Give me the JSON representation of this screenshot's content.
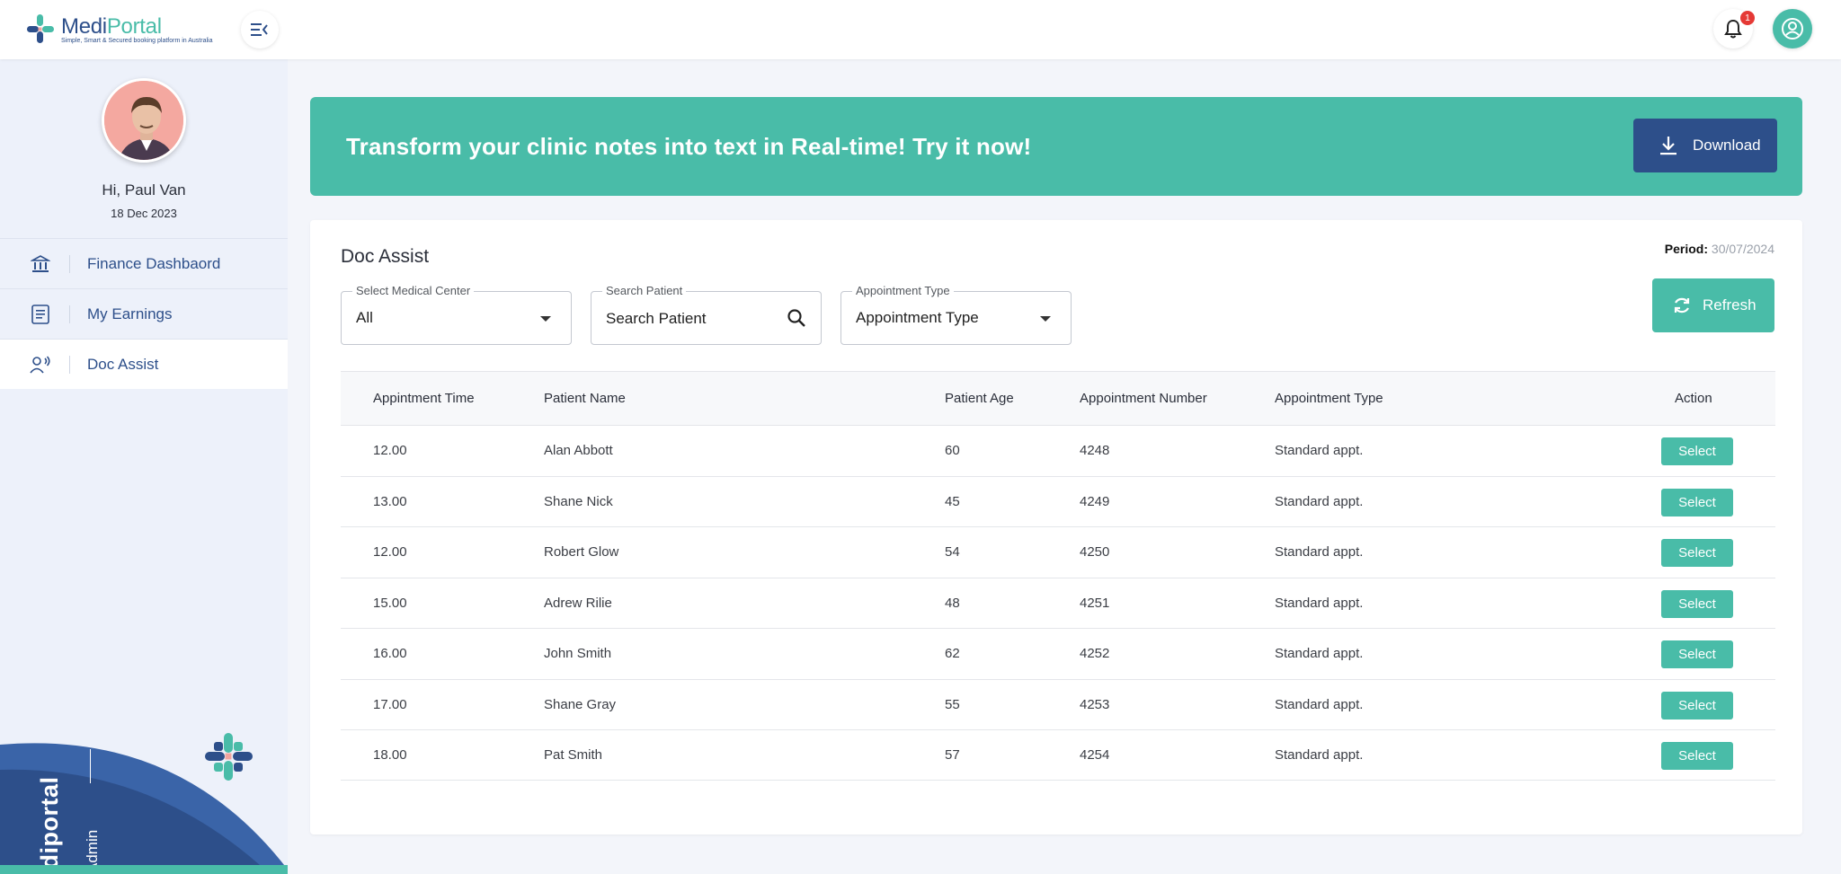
{
  "app": {
    "name_part1": "Medi",
    "name_part2": "Portal",
    "tagline": "Simple, Smart & Secured booking platform in Australia",
    "notification_count": "1"
  },
  "sidebar": {
    "greeting": "Hi, Paul Van",
    "date": "18 Dec 2023",
    "items": [
      {
        "label": "Finance Dashbaord",
        "icon": "bank-icon"
      },
      {
        "label": "My Earnings",
        "icon": "document-icon"
      },
      {
        "label": "Doc Assist",
        "icon": "user-voice-icon"
      }
    ],
    "brand_name": "Mediportal",
    "brand_role": "Admin"
  },
  "banner": {
    "text": "Transform your clinic notes into text in Real-time! Try it now!",
    "download_label": "Download"
  },
  "doc_assist": {
    "title": "Doc Assist",
    "period_label": "Period:",
    "period_value": "30/07/2024",
    "filters": {
      "medical_center_label": "Select Medical Center",
      "medical_center_value": "All",
      "search_label": "Search Patient",
      "search_placeholder": "Search Patient",
      "appt_type_label": "Appointment Type",
      "appt_type_value": "Appointment Type"
    },
    "refresh_label": "Refresh",
    "columns": [
      "Appintment Time",
      "Patient Name",
      "Patient Age",
      "Appointment Number",
      "Appointment Type",
      "Action"
    ],
    "rows": [
      {
        "time": "12.00",
        "name": "Alan Abbott",
        "age": "60",
        "number": "4248",
        "type": "Standard appt.",
        "action": "Select"
      },
      {
        "time": "13.00",
        "name": "Shane Nick",
        "age": "45",
        "number": "4249",
        "type": "Standard appt.",
        "action": "Select"
      },
      {
        "time": "12.00",
        "name": "Robert Glow",
        "age": "54",
        "number": "4250",
        "type": "Standard appt.",
        "action": "Select"
      },
      {
        "time": "15.00",
        "name": "Adrew Rilie",
        "age": "48",
        "number": "4251",
        "type": "Standard appt.",
        "action": "Select"
      },
      {
        "time": "16.00",
        "name": "John Smith",
        "age": "62",
        "number": "4252",
        "type": "Standard appt.",
        "action": "Select"
      },
      {
        "time": "17.00",
        "name": "Shane Gray",
        "age": "55",
        "number": "4253",
        "type": "Standard appt.",
        "action": "Select"
      },
      {
        "time": "18.00",
        "name": "Pat Smith",
        "age": "57",
        "number": "4254",
        "type": "Standard appt.",
        "action": "Select"
      }
    ]
  },
  "colors": {
    "teal": "#49bca8",
    "navy": "#2d4f8a",
    "sidebar_bg": "#edf1fa"
  }
}
